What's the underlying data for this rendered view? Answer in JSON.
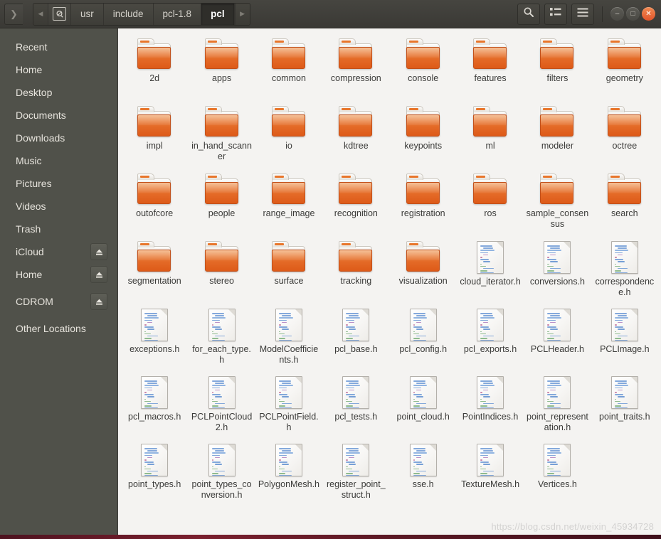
{
  "window": {
    "title": "pcl",
    "controls": {
      "minimize": "–",
      "maximize": "□",
      "close": "✕"
    }
  },
  "header": {
    "nav_forward_history": "❯",
    "path_scroll_left": "◀",
    "path_scroll_right": "▶",
    "breadcrumb": [
      {
        "label": "",
        "icon": "filesystem-root-icon",
        "active": false
      },
      {
        "label": "usr",
        "active": false
      },
      {
        "label": "include",
        "active": false
      },
      {
        "label": "pcl-1.8",
        "active": false
      },
      {
        "label": "pcl",
        "active": true
      }
    ],
    "tools": [
      {
        "name": "search-icon",
        "label": "Search"
      },
      {
        "name": "view-toggle-icon",
        "label": "Toggle view"
      },
      {
        "name": "hamburger-menu-icon",
        "label": "Menu"
      }
    ]
  },
  "sidebar": {
    "items": [
      {
        "label": "Recent",
        "eject": false
      },
      {
        "label": "Home",
        "eject": false
      },
      {
        "label": "Desktop",
        "eject": false
      },
      {
        "label": "Documents",
        "eject": false
      },
      {
        "label": "Downloads",
        "eject": false
      },
      {
        "label": "Music",
        "eject": false
      },
      {
        "label": "Pictures",
        "eject": false
      },
      {
        "label": "Videos",
        "eject": false
      },
      {
        "label": "Trash",
        "eject": false
      },
      {
        "label": "iCloud",
        "eject": true
      },
      {
        "label": "Home",
        "eject": true
      },
      {
        "label": "CDROM",
        "eject": true,
        "gap_before": true
      },
      {
        "label": "Other Locations",
        "eject": false,
        "gap_before": true
      }
    ]
  },
  "files": [
    {
      "name": "2d",
      "type": "folder"
    },
    {
      "name": "apps",
      "type": "folder"
    },
    {
      "name": "common",
      "type": "folder"
    },
    {
      "name": "compression",
      "type": "folder"
    },
    {
      "name": "console",
      "type": "folder"
    },
    {
      "name": "features",
      "type": "folder"
    },
    {
      "name": "filters",
      "type": "folder"
    },
    {
      "name": "geometry",
      "type": "folder"
    },
    {
      "name": "impl",
      "type": "folder"
    },
    {
      "name": "in_hand_scanner",
      "type": "folder"
    },
    {
      "name": "io",
      "type": "folder"
    },
    {
      "name": "kdtree",
      "type": "folder"
    },
    {
      "name": "keypoints",
      "type": "folder"
    },
    {
      "name": "ml",
      "type": "folder"
    },
    {
      "name": "modeler",
      "type": "folder"
    },
    {
      "name": "octree",
      "type": "folder"
    },
    {
      "name": "outofcore",
      "type": "folder"
    },
    {
      "name": "people",
      "type": "folder"
    },
    {
      "name": "range_image",
      "type": "folder"
    },
    {
      "name": "recognition",
      "type": "folder"
    },
    {
      "name": "registration",
      "type": "folder"
    },
    {
      "name": "ros",
      "type": "folder"
    },
    {
      "name": "sample_consensus",
      "type": "folder"
    },
    {
      "name": "search",
      "type": "folder"
    },
    {
      "name": "segmentation",
      "type": "folder"
    },
    {
      "name": "stereo",
      "type": "folder"
    },
    {
      "name": "surface",
      "type": "folder"
    },
    {
      "name": "tracking",
      "type": "folder"
    },
    {
      "name": "visualization",
      "type": "folder"
    },
    {
      "name": "cloud_iterator.h",
      "type": "file"
    },
    {
      "name": "conversions.h",
      "type": "file"
    },
    {
      "name": "correspondence.h",
      "type": "file"
    },
    {
      "name": "exceptions.h",
      "type": "file"
    },
    {
      "name": "for_each_type.h",
      "type": "file"
    },
    {
      "name": "ModelCoefficients.h",
      "type": "file"
    },
    {
      "name": "pcl_base.h",
      "type": "file"
    },
    {
      "name": "pcl_config.h",
      "type": "file"
    },
    {
      "name": "pcl_exports.h",
      "type": "file"
    },
    {
      "name": "PCLHeader.h",
      "type": "file"
    },
    {
      "name": "PCLImage.h",
      "type": "file"
    },
    {
      "name": "pcl_macros.h",
      "type": "file"
    },
    {
      "name": "PCLPointCloud2.h",
      "type": "file"
    },
    {
      "name": "PCLPointField.h",
      "type": "file"
    },
    {
      "name": "pcl_tests.h",
      "type": "file"
    },
    {
      "name": "point_cloud.h",
      "type": "file"
    },
    {
      "name": "PointIndices.h",
      "type": "file"
    },
    {
      "name": "point_representation.h",
      "type": "file"
    },
    {
      "name": "point_traits.h",
      "type": "file"
    },
    {
      "name": "point_types.h",
      "type": "file"
    },
    {
      "name": "point_types_conversion.h",
      "type": "file"
    },
    {
      "name": "PolygonMesh.h",
      "type": "file"
    },
    {
      "name": "register_point_struct.h",
      "type": "file"
    },
    {
      "name": "sse.h",
      "type": "file"
    },
    {
      "name": "TextureMesh.h",
      "type": "file"
    },
    {
      "name": "Vertices.h",
      "type": "file"
    }
  ],
  "watermark": "https://blog.csdn.net/weixin_45934728",
  "colors": {
    "folder_orange": "#e46a27",
    "close_button": "#e2542a",
    "header_bg": "#3f3e39",
    "sidebar_bg": "#50514a",
    "fileview_bg": "#f4f3f1",
    "text_light": "#e6e3dc",
    "text_dark": "#3b3b39"
  }
}
